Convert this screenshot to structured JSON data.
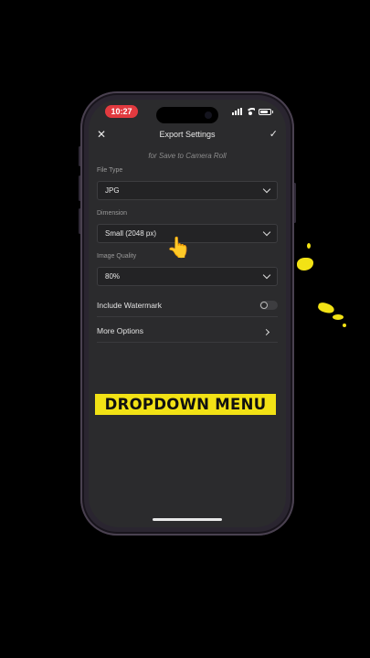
{
  "status_bar": {
    "time": "10:27"
  },
  "nav": {
    "close_icon": "close-icon",
    "title": "Export Settings",
    "done_icon": "checkmark-icon"
  },
  "subtitle": "for Save to Camera Roll",
  "fields": {
    "file_type": {
      "label": "File Type",
      "value": "JPG"
    },
    "dimension": {
      "label": "Dimension",
      "value": "Small (2048 px)"
    },
    "image_quality": {
      "label": "Image Quality",
      "value": "80%"
    }
  },
  "rows": {
    "watermark": {
      "label": "Include Watermark",
      "enabled": false
    },
    "more_options": {
      "label": "More Options"
    }
  },
  "caption": "DROPDOWN MENU",
  "pointer_emoji": "👆",
  "colors": {
    "caption_bg": "#f2e215",
    "time_pill": "#e23a3f",
    "screen_bg": "#2b2b2d"
  }
}
